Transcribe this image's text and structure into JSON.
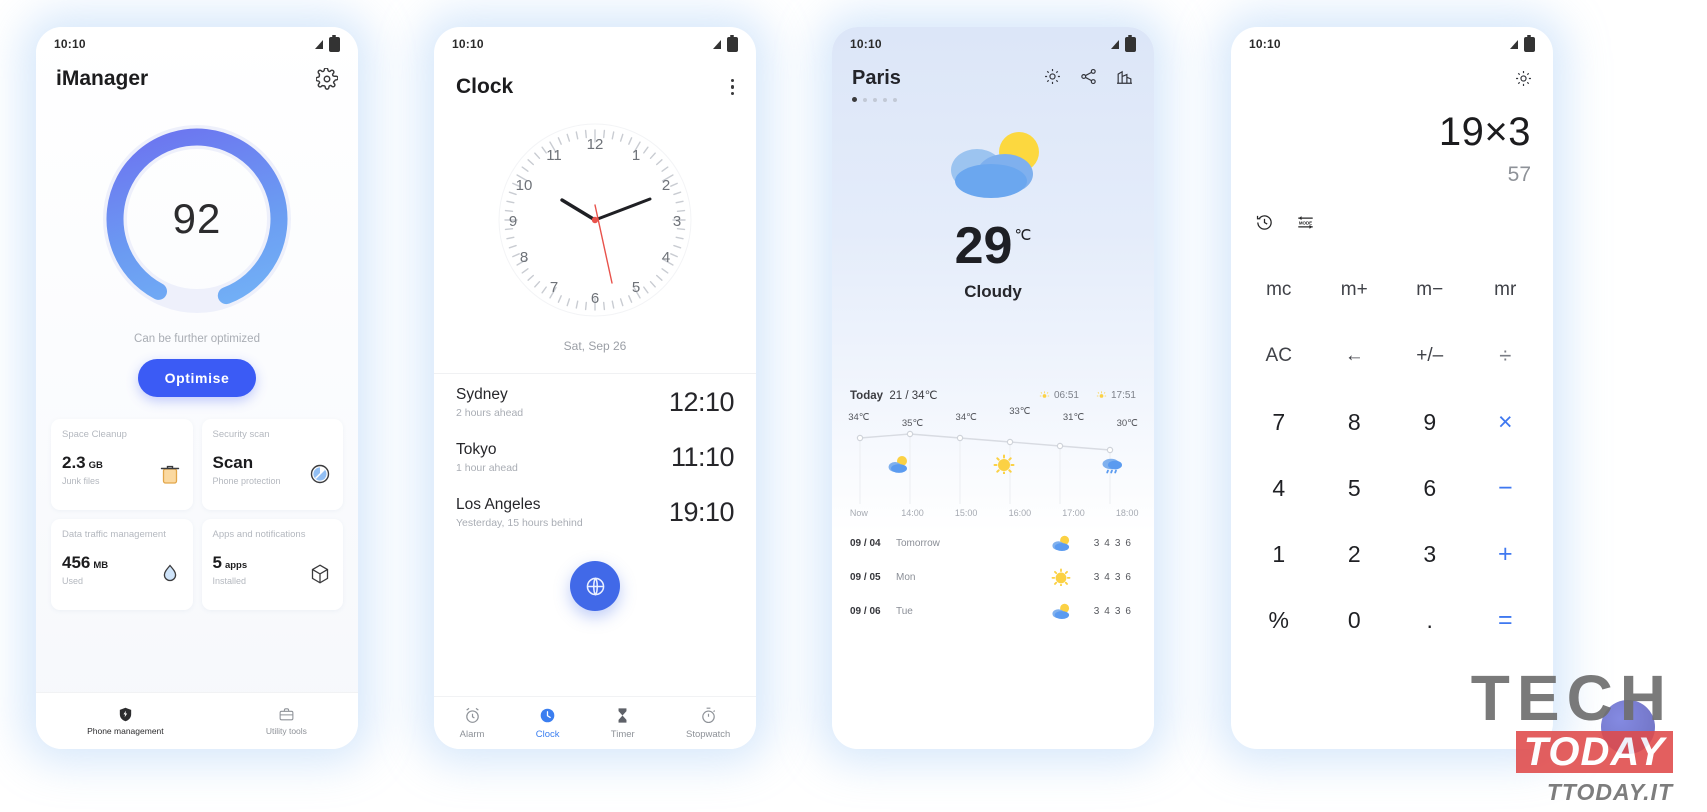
{
  "statusbar": {
    "time": "10:10",
    "signal_icon": "signal-icon",
    "battery_icon": "battery-icon"
  },
  "phone1": {
    "title": "iManager",
    "settings_icon": "gear-icon",
    "score": "92",
    "hint": "Can be further optimized",
    "optimise_label": "Optimise",
    "tiles": [
      {
        "name": "Space Cleanup",
        "value": "2.3",
        "unit": "GB",
        "sub": "Junk files",
        "icon": "trash-icon"
      },
      {
        "name": "Security scan",
        "value": "Scan",
        "unit": "",
        "sub": "Phone protection",
        "icon": "shield-scan-icon"
      },
      {
        "name": "Data traffic management",
        "value": "456",
        "unit": "MB",
        "sub": "Used",
        "icon": "water-drop-icon"
      },
      {
        "name": "Apps and notifications",
        "value": "5",
        "unit": "apps",
        "sub": "Installed",
        "icon": "cube-icon"
      }
    ],
    "nav": [
      {
        "label": "Phone management",
        "icon": "shield-bolt-icon",
        "active": true
      },
      {
        "label": "Utility tools",
        "icon": "toolbox-icon",
        "active": false
      }
    ]
  },
  "phone2": {
    "title": "Clock",
    "overflow_icon": "more-vertical-icon",
    "clock_numerals": [
      "12",
      "1",
      "2",
      "3",
      "4",
      "5",
      "6",
      "7",
      "8",
      "9",
      "10",
      "11"
    ],
    "date": "Sat, Sep 26",
    "world_clocks": [
      {
        "city": "Sydney",
        "delta": "2 hours ahead",
        "time": "12:10"
      },
      {
        "city": "Tokyo",
        "delta": "1 hour ahead",
        "time": "11:10"
      },
      {
        "city": "Los Angeles",
        "delta": "Yesterday, 15 hours behind",
        "time": "19:10"
      }
    ],
    "fab_icon": "globe-icon",
    "tabs": [
      {
        "label": "Alarm",
        "icon": "alarm-icon",
        "active": false
      },
      {
        "label": "Clock",
        "icon": "clock-icon",
        "active": true
      },
      {
        "label": "Timer",
        "icon": "hourglass-icon",
        "active": false
      },
      {
        "label": "Stopwatch",
        "icon": "stopwatch-icon",
        "active": false
      }
    ]
  },
  "phone3": {
    "city": "Paris",
    "page_dots": 5,
    "active_dot": 0,
    "header_icons": [
      "gear-icon",
      "share-icon",
      "city-list-icon"
    ],
    "condition_icon": "cloud-sun-icon",
    "temperature": "29",
    "unit": "℃",
    "condition": "Cloudy",
    "today_label": "Today",
    "today_range": "21 / 34℃",
    "sunrise_icon": "sunrise-icon",
    "sunrise": "06:51",
    "sunset_icon": "sunset-icon",
    "sunset": "17:51",
    "hourly": [
      {
        "time": "Now",
        "temp": "34℃",
        "icon": "cloud-sun-icon"
      },
      {
        "time": "14:00",
        "temp": "35℃",
        "icon": "cloud-sun-icon"
      },
      {
        "time": "15:00",
        "temp": "34℃",
        "icon": "sun-icon"
      },
      {
        "time": "16:00",
        "temp": "33℃",
        "icon": "sun-icon"
      },
      {
        "time": "17:00",
        "temp": "31℃",
        "icon": "cloud-sun-icon"
      },
      {
        "time": "18:00",
        "temp": "30℃",
        "icon": "cloud-rain-icon"
      }
    ],
    "daily": [
      {
        "date": "09 / 04",
        "day": "Tomorrow",
        "icon": "cloud-sun-icon",
        "high": "34",
        "low": "36"
      },
      {
        "date": "09 / 05",
        "day": "Mon",
        "icon": "sun-icon",
        "high": "34",
        "low": "36"
      },
      {
        "date": "09 / 06",
        "day": "Tue",
        "icon": "cloud-sun-icon",
        "high": "34",
        "low": "36"
      }
    ]
  },
  "phone4": {
    "settings_icon": "gear-icon",
    "expression": "19×3",
    "result": "57",
    "history_icon": "history-icon",
    "mode_icon": "mode-icon",
    "keys": [
      {
        "label": "mc",
        "type": "fn"
      },
      {
        "label": "m+",
        "type": "fn"
      },
      {
        "label": "m−",
        "type": "fn"
      },
      {
        "label": "mr",
        "type": "fn"
      },
      {
        "label": "AC",
        "type": "fn"
      },
      {
        "label": "←",
        "type": "fn"
      },
      {
        "label": "+/–",
        "type": "fn"
      },
      {
        "label": "÷",
        "type": "op"
      },
      {
        "label": "7",
        "type": "num"
      },
      {
        "label": "8",
        "type": "num"
      },
      {
        "label": "9",
        "type": "num"
      },
      {
        "label": "×",
        "type": "op"
      },
      {
        "label": "4",
        "type": "num"
      },
      {
        "label": "5",
        "type": "num"
      },
      {
        "label": "6",
        "type": "num"
      },
      {
        "label": "−",
        "type": "op"
      },
      {
        "label": "1",
        "type": "num"
      },
      {
        "label": "2",
        "type": "num"
      },
      {
        "label": "3",
        "type": "num"
      },
      {
        "label": "+",
        "type": "op"
      },
      {
        "label": "%",
        "type": "num"
      },
      {
        "label": "0",
        "type": "num"
      },
      {
        "label": ".",
        "type": "num"
      },
      {
        "label": "=",
        "type": "op"
      }
    ]
  },
  "watermark": {
    "line1": "TECH",
    "line2": "TODAY",
    "line3": "TTODAY.IT"
  },
  "colors": {
    "accent_blue": "#3b5bf5",
    "clock_blue": "#4169e8",
    "calc_blue": "#3f78f0",
    "sun_yellow": "#fbd144",
    "cloud_blue": "#5b9bf0"
  }
}
